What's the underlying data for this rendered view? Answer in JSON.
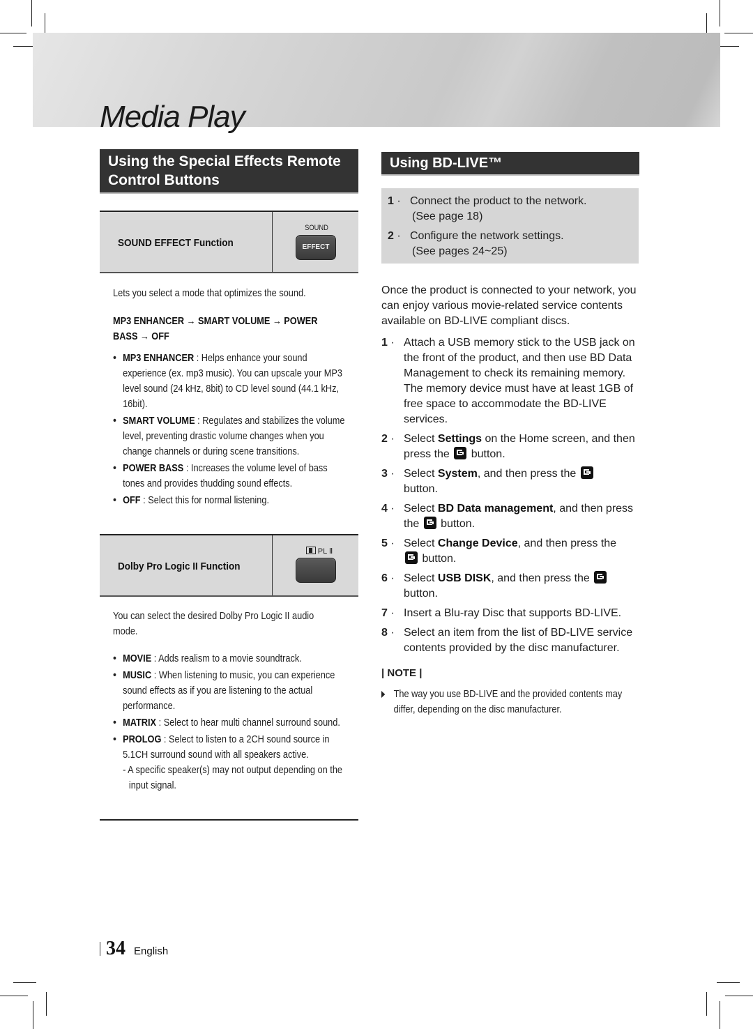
{
  "header": {
    "title": "Media Play"
  },
  "left_section": {
    "heading": "Using the Special Effects Remote Control Buttons",
    "sound_effect": {
      "function_label": "SOUND EFFECT Function",
      "button_caption": "SOUND",
      "button_label": "EFFECT",
      "description": "Lets you select a mode that optimizes the sound.",
      "sequence": "MP3 ENHANCER → SMART VOLUME → POWER BASS → OFF",
      "bullets": [
        {
          "term": "MP3 ENHANCER",
          "text": " : Helps enhance your sound experience (ex. mp3 music). You can upscale your MP3 level sound (24 kHz, 8bit) to CD level sound (44.1 kHz, 16bit)."
        },
        {
          "term": "SMART VOLUME",
          "text": " : Regulates and stabilizes the volume level, preventing drastic volume changes when you change channels or during scene transitions."
        },
        {
          "term": "POWER BASS",
          "text": " : Increases the volume level of bass tones and provides thudding sound effects."
        },
        {
          "term": "OFF",
          "text": " : Select this for normal listening."
        }
      ]
    },
    "dolby": {
      "function_label": "Dolby Pro Logic II Function",
      "button_caption": "PL Ⅱ",
      "description": "You can select the desired Dolby Pro Logic II audio mode.",
      "bullets": [
        {
          "term": "MOVIE",
          "text": " : Adds realism to a movie soundtrack."
        },
        {
          "term": "MUSIC",
          "text": " : When listening to music, you can experience sound effects as if you are listening to the actual performance."
        },
        {
          "term": "MATRIX",
          "text": " : Select to hear multi channel surround sound."
        },
        {
          "term": "PROLOG",
          "text": " : Select to listen to a 2CH sound source in 5.1CH surround sound with all speakers active."
        }
      ],
      "sub_note": "- A specific speaker(s) may not output depending on the input signal."
    }
  },
  "right_section": {
    "heading": "Using BD-LIVE™",
    "prereq_steps": [
      {
        "num": "1",
        "text": "Connect the product to the network.",
        "ref": "(See page 18)"
      },
      {
        "num": "2",
        "text": "Configure the network settings.",
        "ref": "(See pages 24~25)"
      }
    ],
    "intro": "Once the product is connected to your network, you can enjoy various movie-related service contents available on BD-LIVE compliant discs.",
    "steps": [
      {
        "num": "1",
        "pre": "Attach a USB memory stick to the USB jack on the front of the product, and then use BD Data Management to check its remaining memory. The memory device must have at least 1GB of free space to accommodate the BD-LIVE services.",
        "bold": "",
        "post": "",
        "icon": false,
        "tail": ""
      },
      {
        "num": "2",
        "pre": "Select ",
        "bold": "Settings",
        "post": " on the Home screen, and then press the ",
        "icon": true,
        "tail": " button."
      },
      {
        "num": "3",
        "pre": "Select ",
        "bold": "System",
        "post": ", and then press the ",
        "icon": true,
        "tail": " button."
      },
      {
        "num": "4",
        "pre": "Select ",
        "bold": "BD Data management",
        "post": ", and then press the ",
        "icon": true,
        "tail": " button."
      },
      {
        "num": "5",
        "pre": "Select ",
        "bold": "Change Device",
        "post": ", and then press the ",
        "icon": true,
        "tail": " button."
      },
      {
        "num": "6",
        "pre": "Select ",
        "bold": "USB DISK",
        "post": ", and then press the ",
        "icon": true,
        "tail": " button."
      },
      {
        "num": "7",
        "pre": "Insert a Blu-ray Disc that supports BD-LIVE.",
        "bold": "",
        "post": "",
        "icon": false,
        "tail": ""
      },
      {
        "num": "8",
        "pre": "Select an item from the list of BD-LIVE service contents provided by the disc manufacturer.",
        "bold": "",
        "post": "",
        "icon": false,
        "tail": ""
      }
    ],
    "note_title": "| NOTE |",
    "note_text": "The way you use BD-LIVE and the provided contents may differ, depending on the disc manufacturer."
  },
  "footer": {
    "page_number": "34",
    "language": "English"
  }
}
